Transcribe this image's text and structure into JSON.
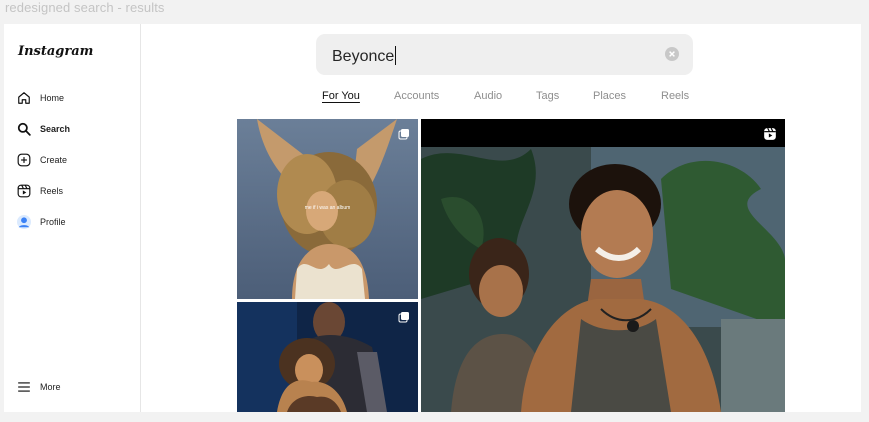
{
  "frame": {
    "title": "redesigned search - results"
  },
  "sidebar": {
    "logo": "Instagram",
    "items": [
      {
        "label": "Home",
        "icon": "home-icon"
      },
      {
        "label": "Search",
        "icon": "search-icon"
      },
      {
        "label": "Create",
        "icon": "create-icon"
      },
      {
        "label": "Reels",
        "icon": "reels-icon"
      },
      {
        "label": "Profile",
        "icon": "profile-avatar-icon"
      }
    ],
    "more": {
      "label": "More",
      "icon": "hamburger-menu-icon"
    }
  },
  "search": {
    "value": "Beyonce"
  },
  "tabs": [
    {
      "label": "For You",
      "active": true
    },
    {
      "label": "Accounts"
    },
    {
      "label": "Audio"
    },
    {
      "label": "Tags"
    },
    {
      "label": "Places"
    },
    {
      "label": "Reels"
    }
  ],
  "results": [
    {
      "type": "multi-photo",
      "icon": "carousel-icon",
      "caption": "me if i was an album"
    },
    {
      "type": "multi-photo",
      "icon": "carousel-icon"
    },
    {
      "type": "reel",
      "icon": "reels-icon"
    }
  ],
  "colors": {
    "accent_profile": "#3b82f6",
    "text": "#262626",
    "muted": "#8e8e8e"
  }
}
